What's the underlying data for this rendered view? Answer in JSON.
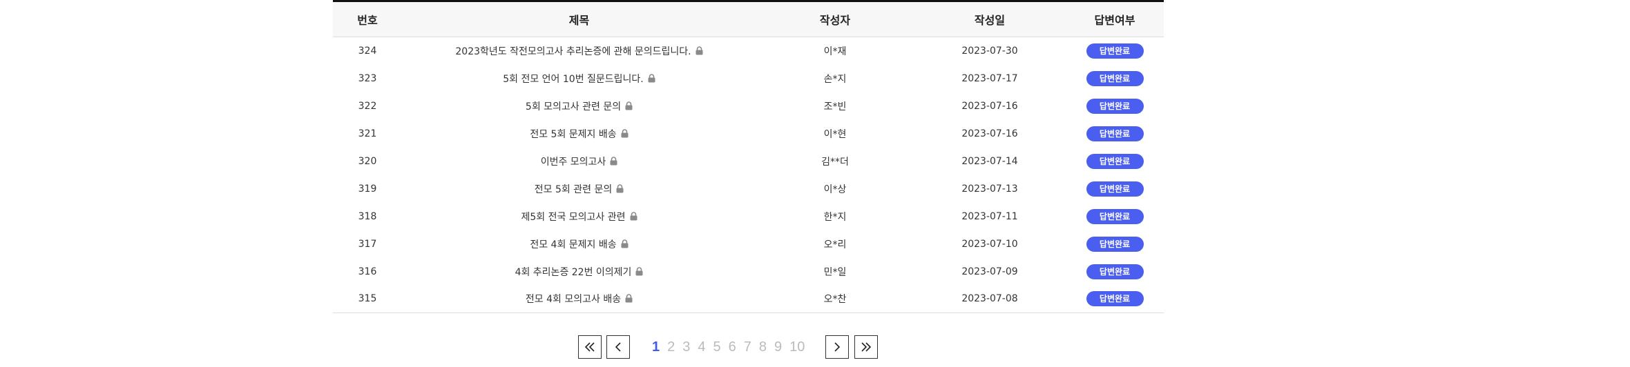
{
  "table": {
    "headers": {
      "no": "번호",
      "title": "제목",
      "author": "작성자",
      "date": "작성일",
      "status": "답변여부"
    },
    "rows": [
      {
        "no": "324",
        "title": "2023학년도 작전모의고사 추리논증에 관해 문의드립니다.",
        "author": "이*재",
        "date": "2023-07-30",
        "status": "답변완료"
      },
      {
        "no": "323",
        "title": "5회 전모 언어 10번 질문드립니다.",
        "author": "손*지",
        "date": "2023-07-17",
        "status": "답변완료"
      },
      {
        "no": "322",
        "title": "5회 모의고사 관련 문의",
        "author": "조*빈",
        "date": "2023-07-16",
        "status": "답변완료"
      },
      {
        "no": "321",
        "title": "전모 5회 문제지 배송",
        "author": "이*현",
        "date": "2023-07-16",
        "status": "답변완료"
      },
      {
        "no": "320",
        "title": "이번주 모의고사",
        "author": "김**더",
        "date": "2023-07-14",
        "status": "답변완료"
      },
      {
        "no": "319",
        "title": "전모 5회 관련 문의",
        "author": "이*상",
        "date": "2023-07-13",
        "status": "답변완료"
      },
      {
        "no": "318",
        "title": "제5회 전국 모의고사 관련",
        "author": "한*지",
        "date": "2023-07-11",
        "status": "답변완료"
      },
      {
        "no": "317",
        "title": "전모 4회 문제지 배송",
        "author": "오*리",
        "date": "2023-07-10",
        "status": "답변완료"
      },
      {
        "no": "316",
        "title": "4회 추리논증 22번 이의제기",
        "author": "민*일",
        "date": "2023-07-09",
        "status": "답변완료"
      },
      {
        "no": "315",
        "title": "전모 4회 모의고사 배송",
        "author": "오*찬",
        "date": "2023-07-08",
        "status": "답변완료"
      }
    ]
  },
  "pagination": {
    "pages": [
      "1",
      "2",
      "3",
      "4",
      "5",
      "6",
      "7",
      "8",
      "9",
      "10"
    ],
    "active_page": "1"
  },
  "colors": {
    "badge": "#4a5ff0",
    "active_page": "#3d5af1",
    "inactive_page": "#bbbbbb"
  },
  "icons": {
    "lock": "lock-icon",
    "first": "double-chevron-left-icon",
    "prev": "chevron-left-icon",
    "next": "chevron-right-icon",
    "last": "double-chevron-right-icon"
  }
}
